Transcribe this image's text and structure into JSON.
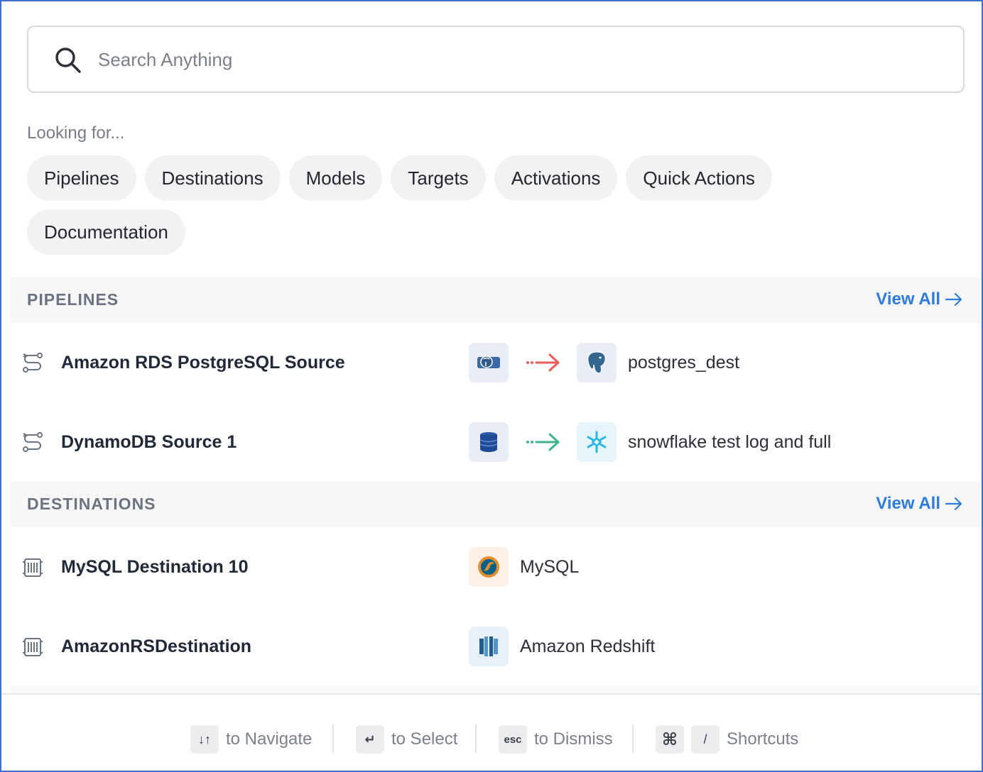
{
  "search": {
    "placeholder": "Search Anything"
  },
  "looking_for": "Looking for...",
  "chips": [
    "Pipelines",
    "Destinations",
    "Models",
    "Targets",
    "Activations",
    "Quick Actions",
    "Documentation"
  ],
  "sections": {
    "pipelines": {
      "title": "PIPELINES",
      "view_all": "View All",
      "items": [
        {
          "label": "Amazon RDS PostgreSQL Source",
          "source_icon": "postgres-rds-icon",
          "dest_icon": "postgres-icon",
          "destination": "postgres_dest",
          "arrow_color": "#ef5b5b"
        },
        {
          "label": "DynamoDB Source 1",
          "source_icon": "dynamodb-icon",
          "dest_icon": "snowflake-icon",
          "destination": "snowflake test log and full",
          "arrow_color": "#3db58a"
        }
      ]
    },
    "destinations": {
      "title": "DESTINATIONS",
      "view_all": "View All",
      "items": [
        {
          "label": "MySQL Destination 10",
          "type_icon": "mysql-icon",
          "type": "MySQL"
        },
        {
          "label": "AmazonRSDestination",
          "type_icon": "redshift-icon",
          "type": "Amazon Redshift"
        }
      ]
    }
  },
  "footer": {
    "navigate": {
      "key": "↓↑",
      "text": "to Navigate"
    },
    "select": {
      "key": "↵",
      "text": "to Select"
    },
    "dismiss": {
      "key": "esc",
      "text": "to Dismiss"
    },
    "shortcuts": {
      "key1": "⌘",
      "key2": "/",
      "text": "Shortcuts"
    }
  },
  "colors": {
    "accent": "#2d7be0",
    "frame": "#3b6fd4"
  }
}
